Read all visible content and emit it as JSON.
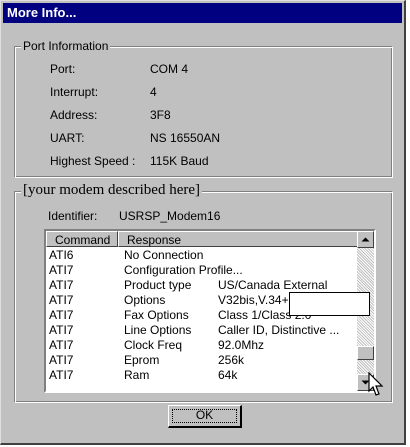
{
  "window": {
    "title": "More Info..."
  },
  "port_info": {
    "legend": "Port Information",
    "rows": [
      {
        "label": "Port:",
        "value": "COM 4"
      },
      {
        "label": "Interrupt:",
        "value": "4"
      },
      {
        "label": "Address:",
        "value": "3F8"
      },
      {
        "label": "UART:",
        "value": "NS 16550AN"
      },
      {
        "label": "Highest Speed :",
        "value": "115K Baud"
      }
    ]
  },
  "modem": {
    "legend": "[your modem described here]",
    "identifier_label": "Identifier:",
    "identifier_value": "USRSP_Modem16",
    "columns": [
      "Command",
      "Response"
    ],
    "rows": [
      {
        "cmd": "ATI6",
        "resp": "No Connection",
        "resp2": ""
      },
      {
        "cmd": "ATI7",
        "resp": "Configuration Profile...",
        "resp2": ""
      },
      {
        "cmd": "ATI7",
        "resp": "Product type",
        "resp2": "US/Canada External"
      },
      {
        "cmd": "ATI7",
        "resp": "Options",
        "resp2": "V32bis,V.34+,x2  ,V.PCM"
      },
      {
        "cmd": "ATI7",
        "resp": "Fax Options",
        "resp2": "Class 1/Class 2.0"
      },
      {
        "cmd": "ATI7",
        "resp": "Line Options",
        "resp2": "Caller ID, Distinctive ..."
      },
      {
        "cmd": "ATI7",
        "resp": "Clock Freq",
        "resp2": "92.0Mhz"
      },
      {
        "cmd": "ATI7",
        "resp": "Eprom",
        "resp2": "256k"
      },
      {
        "cmd": "ATI7",
        "resp": "Ram",
        "resp2": "64k"
      }
    ]
  },
  "buttons": {
    "ok": "OK"
  },
  "icons": {
    "scroll_up": "arrow-up-icon",
    "scroll_down": "arrow-down-icon",
    "cursor": "mouse-pointer-icon"
  }
}
